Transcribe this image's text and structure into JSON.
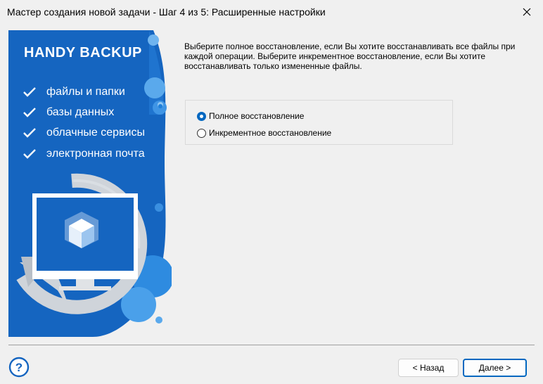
{
  "window": {
    "title": "Мастер создания новой задачи - Шаг 4 из 5: Расширенные настройки",
    "close_icon": "close-icon"
  },
  "banner": {
    "logo": "HANDY BACKUP",
    "features": [
      "файлы и папки",
      "базы данных",
      "облачные сервисы",
      "электронная почта"
    ],
    "colors": {
      "primary": "#1565c0",
      "accent": "#2e8be0",
      "ring": "#cfd4da"
    }
  },
  "main": {
    "description": "Выберите полное восстановление, если Вы хотите восстанавливать все файлы при каждой операции. Выберите инкрементное восстановление, если Вы хотите восстанавливать только измененные файлы.",
    "options": [
      {
        "label": "Полное восстановление",
        "selected": true
      },
      {
        "label": "Инкрементное восстановление",
        "selected": false
      }
    ]
  },
  "footer": {
    "help_icon": "help-icon",
    "back_label": "< Назад",
    "next_label": "Далее >"
  }
}
